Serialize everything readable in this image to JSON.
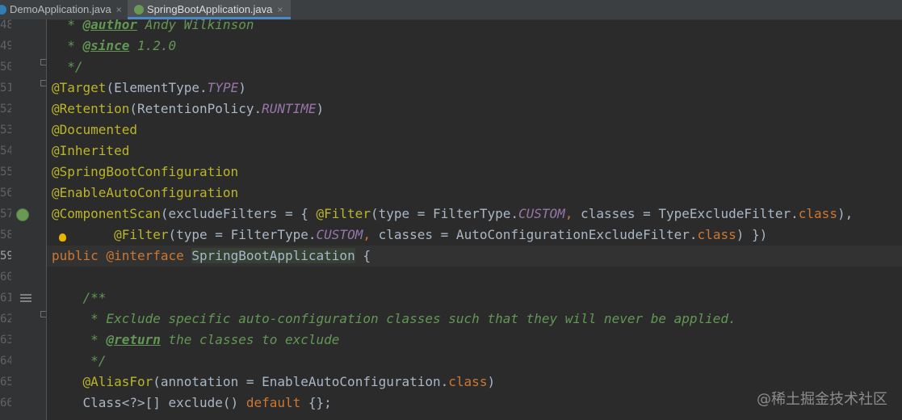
{
  "tabs": [
    {
      "label": "DemoApplication.java",
      "close": "×",
      "icon": "java-class-icon",
      "active": false
    },
    {
      "label": "SpringBootApplication.java",
      "close": "×",
      "icon": "spring-boot-class-icon",
      "active": true
    }
  ],
  "gutter": {
    "line_numbers": [
      "48",
      "49",
      "50",
      "51",
      "52",
      "53",
      "54",
      "55",
      "56",
      "57",
      "58",
      "59",
      "60",
      "61",
      "62",
      "63",
      "64",
      "65",
      "66"
    ],
    "current_line": "59",
    "icons": {
      "line_57": "spring-bean-icon",
      "line_58": "lightbulb-icon",
      "line_61": "javadoc-icon"
    }
  },
  "code": {
    "l48": {
      "lead": "  * ",
      "tag": "@author",
      "rest": " Andy Wilkinson"
    },
    "l49": {
      "lead": "  * ",
      "tag": "@since",
      "rest": " 1.2.0"
    },
    "l50": {
      "text": "  */"
    },
    "l51": {
      "ann": "@Target",
      "p1": "(ElementType.",
      "cst": "TYPE",
      "p2": ")"
    },
    "l52": {
      "ann": "@Retention",
      "p1": "(RetentionPolicy.",
      "cst": "RUNTIME",
      "p2": ")"
    },
    "l53": {
      "ann": "@Documented"
    },
    "l54": {
      "ann": "@Inherited"
    },
    "l55": {
      "ann": "@SpringBootConfiguration"
    },
    "l56": {
      "ann": "@EnableAutoConfiguration"
    },
    "l57": {
      "ann": "@ComponentScan",
      "p1": "(excludeFilters = { ",
      "ann2": "@Filter",
      "p2": "(type = FilterType.",
      "cst": "CUSTOM",
      "kw1": ",",
      "p3": " classes = TypeExcludeFilter.",
      "kw2": "class",
      "p4": "),"
    },
    "l58": {
      "indent": "        ",
      "ann": "@Filter",
      "p1": "(type = FilterType.",
      "cst": "CUSTOM",
      "kw1": ",",
      "p2": " classes = AutoConfigurationExcludeFilter.",
      "kw2": "class",
      "p3": ") })"
    },
    "l59": {
      "kw": "public",
      "sp": " ",
      "ann": "@interface",
      "sp2": " ",
      "name": "SpringBootApplication",
      "rest": " {"
    },
    "l61": {
      "text": "    /**"
    },
    "l62": {
      "text": "     * Exclude specific auto-configuration classes such that they will never be applied."
    },
    "l63": {
      "lead": "     * ",
      "tag": "@return",
      "rest": " the classes to exclude"
    },
    "l64": {
      "text": "     */"
    },
    "l65": {
      "indent": "    ",
      "ann": "@AliasFor",
      "p1": "(annotation = EnableAutoConfiguration.",
      "kw": "class",
      "p2": ")"
    },
    "l66": {
      "indent": "    ",
      "p1": "Class<?>[] exclude() ",
      "kw": "default",
      "p2": " {};"
    }
  },
  "watermark": "@稀土掘金技术社区",
  "colors": {
    "background": "#2b2b2b",
    "gutter": "#313335",
    "annotation": "#bbb529",
    "keyword": "#cc7832",
    "javadoc": "#629755",
    "constant": "#9876aa",
    "text": "#a9b7c6"
  }
}
